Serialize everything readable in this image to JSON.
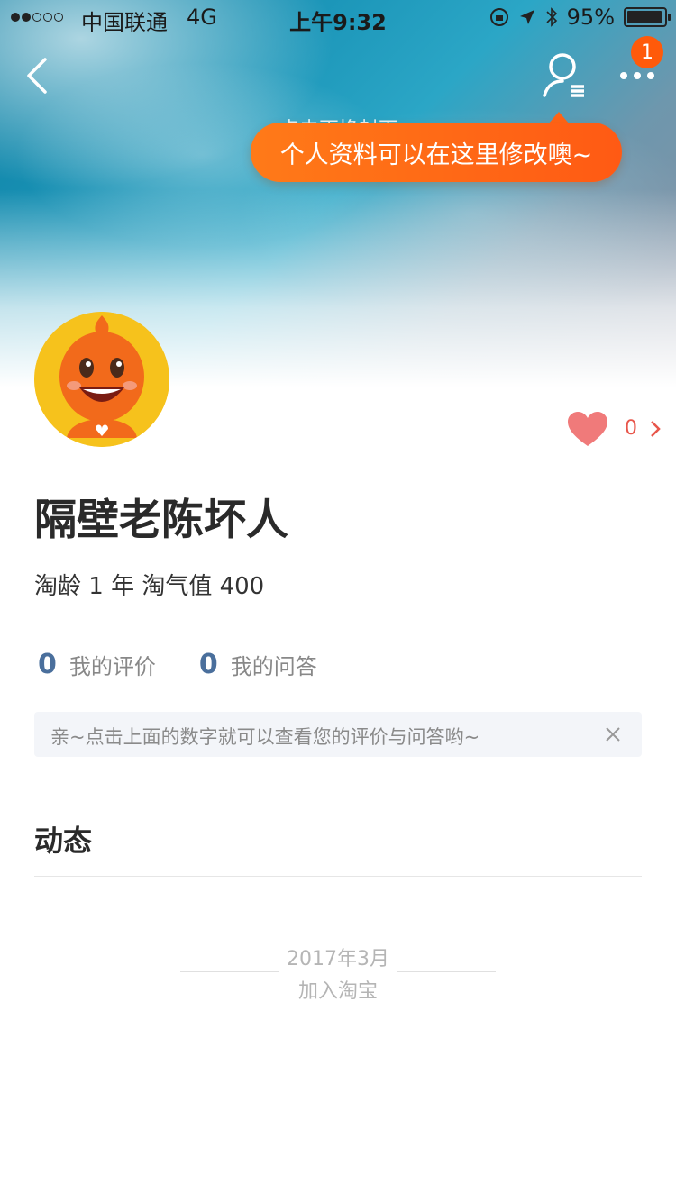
{
  "status_bar": {
    "carrier": "中国联通",
    "network": "4G",
    "time": "上午9:32",
    "battery": "95%"
  },
  "nav": {
    "badge_count": "1",
    "icons": [
      "back-icon",
      "profile-edit-icon",
      "more-icon"
    ]
  },
  "cover": {
    "hint_text": "点击更换封面"
  },
  "tooltip": {
    "text": "个人资料可以在这里修改噢~"
  },
  "profile": {
    "username": "隔壁老陈坏人",
    "meta": "淘龄 1 年  淘气值 400",
    "likes": "0"
  },
  "counts": [
    {
      "num": "0",
      "label": "我的评价"
    },
    {
      "num": "0",
      "label": "我的问答"
    }
  ],
  "notice": {
    "text": "亲~点击上面的数字就可以查看您的评价与问答哟~"
  },
  "section": {
    "title": "动态"
  },
  "timeline": {
    "date": "2017年3月",
    "text": "加入淘宝"
  },
  "colors": {
    "accent_orange": "#ff5a14",
    "count_blue": "#4a6f9c",
    "heart": "#f07a7a"
  }
}
